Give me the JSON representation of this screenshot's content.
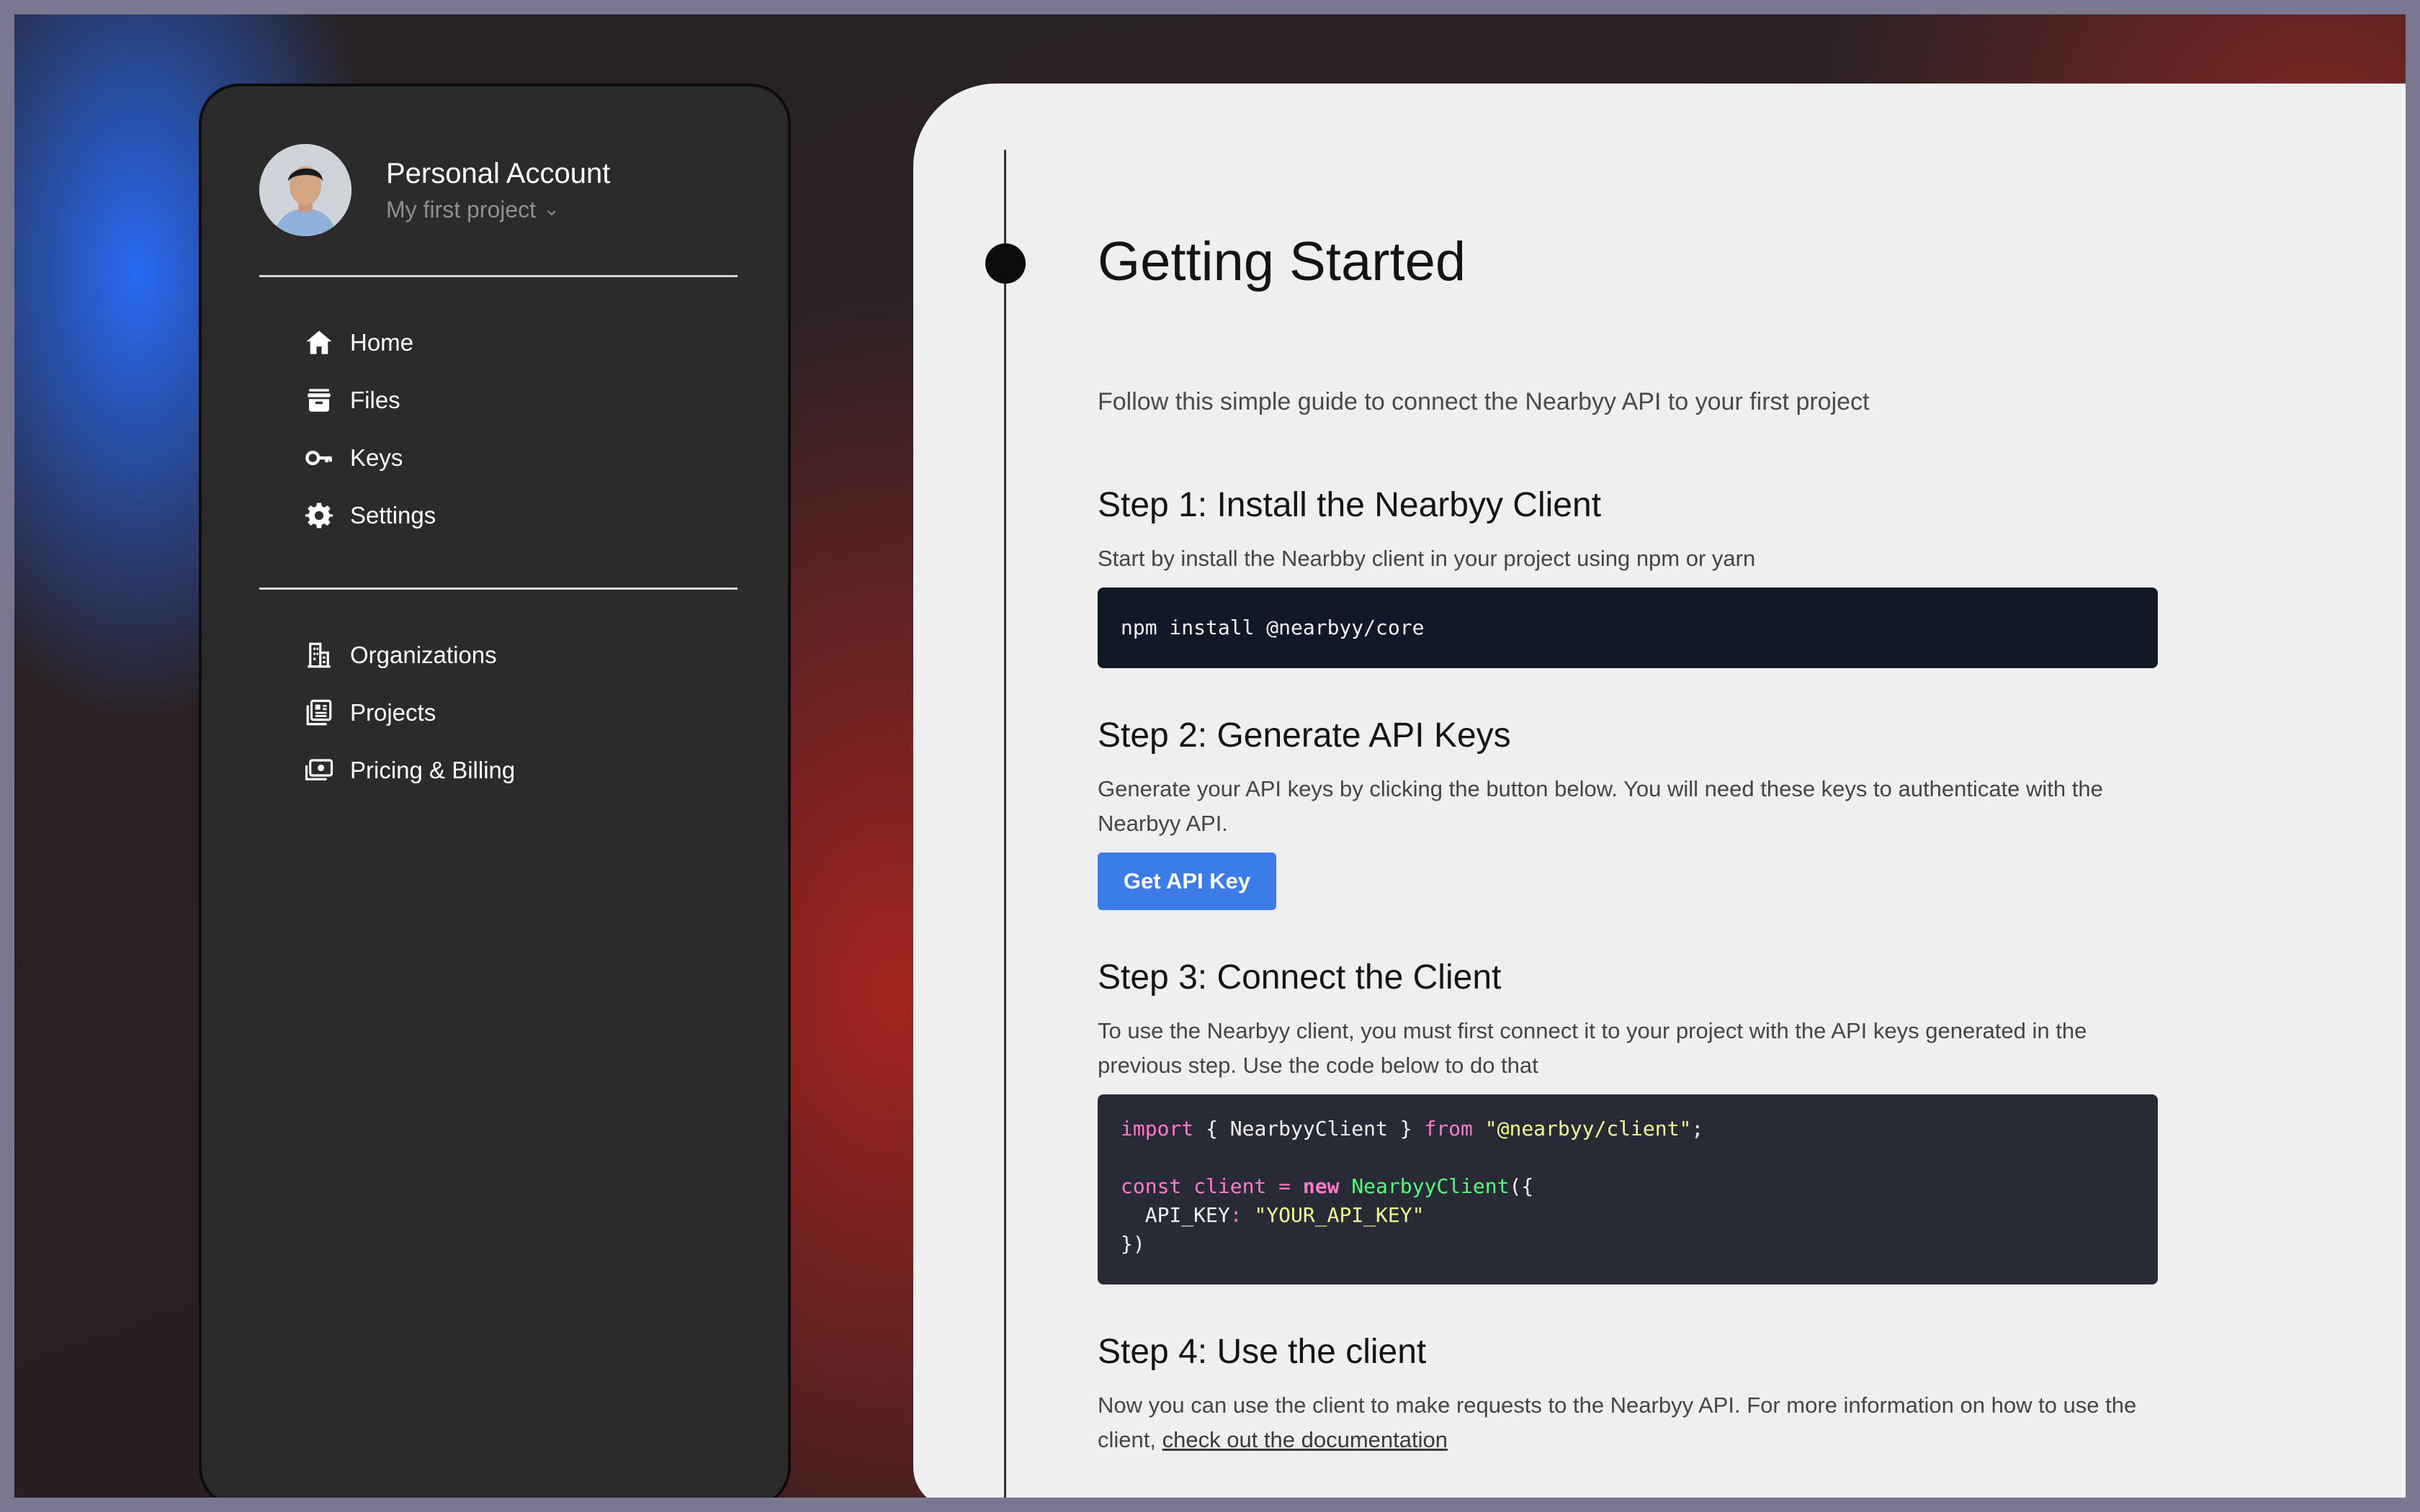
{
  "sidebar": {
    "account_title": "Personal Account",
    "project_selector": "My first project",
    "nav_main": [
      {
        "label": "Home",
        "icon": "home-icon"
      },
      {
        "label": "Files",
        "icon": "archive-icon"
      },
      {
        "label": "Keys",
        "icon": "key-icon"
      },
      {
        "label": "Settings",
        "icon": "gear-icon"
      }
    ],
    "nav_secondary": [
      {
        "label": "Organizations",
        "icon": "building-icon"
      },
      {
        "label": "Projects",
        "icon": "projects-icon"
      },
      {
        "label": "Pricing & Billing",
        "icon": "cash-icon"
      }
    ]
  },
  "main": {
    "title": "Getting Started",
    "subtitle": "Follow this simple guide to connect the Nearbyy API to your first project",
    "step1": {
      "heading": "Step 1: Install the Nearbyy Client",
      "text": "Start by install the Nearbby client in your project using npm or yarn",
      "code": "npm install @nearbyy/core"
    },
    "step2": {
      "heading": "Step 2: Generate API Keys",
      "text": "Generate your API keys by clicking the button below. You will need these keys to authenticate with the Nearbyy API.",
      "button": "Get API Key"
    },
    "step3": {
      "heading": "Step 3: Connect the Client",
      "text": "To use the Nearbyy client, you must first connect it to your project with the API keys generated in the previous step. Use the code below to do that",
      "code": {
        "l1_import": "import",
        "l1_mid": " { NearbyyClient } ",
        "l1_from": "from",
        "l1_space": " ",
        "l1_str": "\"@nearbyy/client\"",
        "l1_end": ";",
        "l3_const": "const client ",
        "l3_eq": "=",
        "l3_space": " ",
        "l3_new": "new",
        "l3_space2": " ",
        "l3_fn": "NearbyyClient",
        "l3_end": "({",
        "l4_key": "  API_KEY",
        "l4_colon": ":",
        "l4_space": " ",
        "l4_str": "\"YOUR_API_KEY\"",
        "l5": "})"
      }
    },
    "step4": {
      "heading": "Step 4: Use the client",
      "text": "Now you can use the client to make requests to the Nearbyy API. For more information on how to use the client,",
      "link": "check out the documentation"
    }
  },
  "colors": {
    "primary_button": "#3b7ce9",
    "sidebar_bg": "#2b2b2b",
    "panel_bg": "#efefef",
    "code_dark": "#111827",
    "code_editor": "#282a36"
  }
}
